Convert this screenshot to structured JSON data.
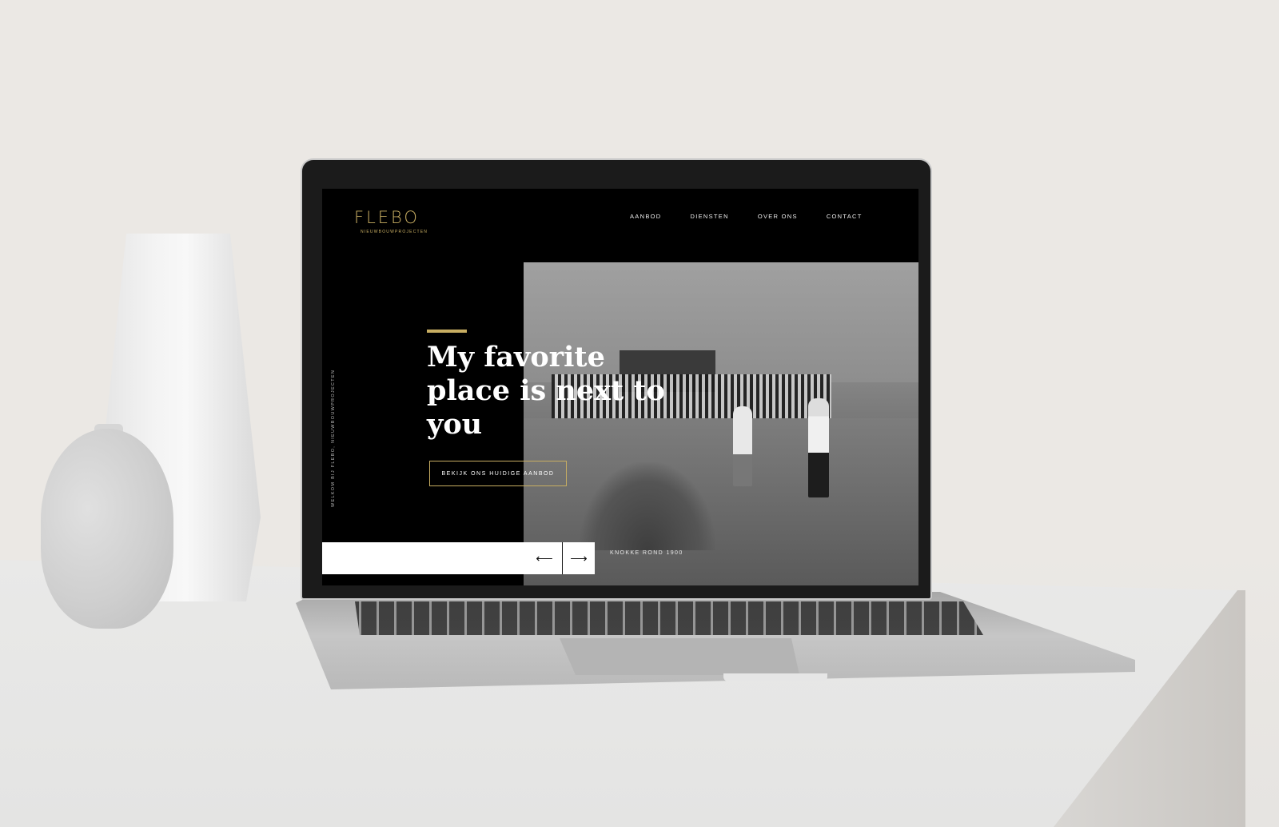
{
  "site": {
    "logo": "FLEBO",
    "logo_sub": "NIEUWBOUWPROJECTEN",
    "nav": [
      "AANBOD",
      "DIENSTEN",
      "OVER ONS",
      "CONTACT"
    ],
    "side_text": "WELKOM BIJ FLEBO, NIEUWBOUWPROJECTEN",
    "headline": "My favorite place is next to you",
    "cta_label": "BEKIJK ONS HUIDIGE AANBOD",
    "caption": "KNOKKE ROND 1900",
    "prev_icon": "arrow-left-icon",
    "next_icon": "arrow-right-icon",
    "accent_color": "#c8ae62"
  }
}
